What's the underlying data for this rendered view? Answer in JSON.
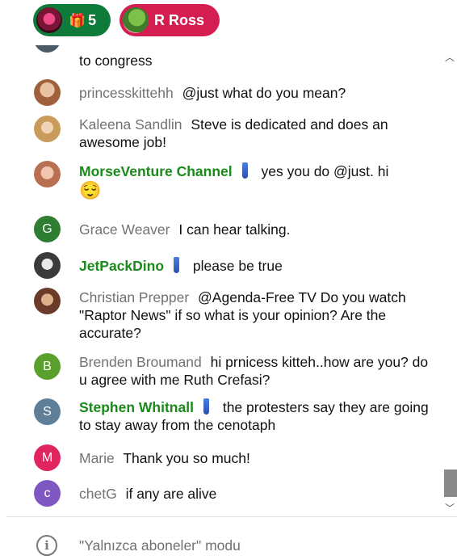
{
  "top_bar": {
    "gift_count": "5",
    "user_pill_name": "R Ross"
  },
  "messages": [
    {
      "author": "",
      "text": "to congress",
      "avatar": "photo",
      "color": "#4a5a66"
    },
    {
      "author": "princesskittehh",
      "text": "@just what do you mean?",
      "avatar": "photo",
      "color": "#c89070"
    },
    {
      "author": "Kaleena Sandlin",
      "text": "Steve is dedicated and does an awesome job!",
      "avatar": "photo",
      "color": "#b88a55"
    },
    {
      "author": "MorseVenture Channel",
      "text": "yes you do @just. hi",
      "emoji": "😌",
      "member": true,
      "avatar": "photo",
      "color": "#c98a70"
    },
    {
      "author": "Grace Weaver",
      "text": "I can hear talking.",
      "avatar": "G",
      "color": "#2e7d32"
    },
    {
      "author": "JetPackDino",
      "text": "please be true",
      "member": true,
      "avatar": "photo",
      "color": "#3a3a3a"
    },
    {
      "author": "Christian Prepper",
      "text": "@Agenda-Free TV Do you watch \"Raptor News\" if so what is your opinion? Are the accurate?",
      "avatar": "photo",
      "color": "#a0604a"
    },
    {
      "author": "Brenden Broumand",
      "text": "hi prnicess kitteh..how are you? do u agree with me Ruth Crefasi?",
      "avatar": "B",
      "color": "#5aa02c"
    },
    {
      "author": "Stephen Whitnall",
      "text": "the protesters say they are going to stay away from the cenotaph",
      "member": true,
      "avatar": "S",
      "color": "#5f7f99"
    },
    {
      "author": "Marie",
      "text": "Thank you so much!",
      "avatar": "M",
      "color": "#e0245e"
    },
    {
      "author": "chetG",
      "text": "if any are alive",
      "avatar": "c",
      "color": "#7e57c2"
    }
  ],
  "footer": {
    "mode_text": "\"Yalnızca aboneler\" modu"
  }
}
